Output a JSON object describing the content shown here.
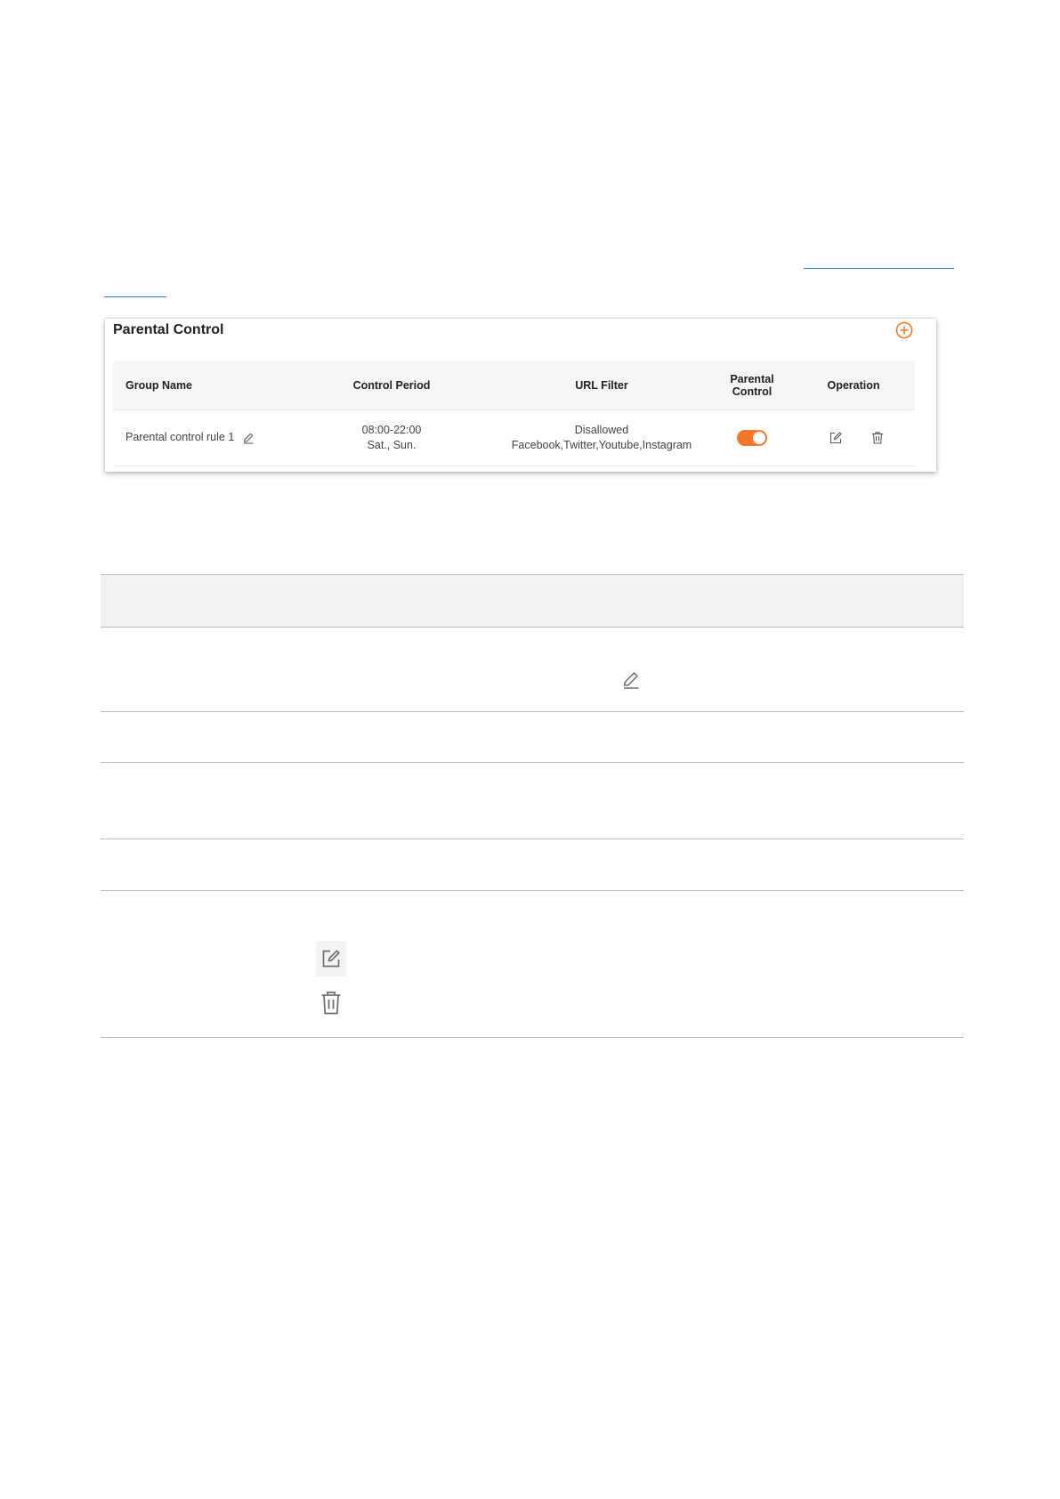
{
  "card": {
    "title": "Parental Control",
    "add_icon": "plus-circle-icon",
    "columns": {
      "group_name": "Group Name",
      "control_period": "Control Period",
      "url_filter": "URL Filter",
      "parental_control_line1": "Parental",
      "parental_control_line2": "Control",
      "operation": "Operation"
    },
    "rows": [
      {
        "group_name": "Parental control rule 1",
        "period_time": "08:00-22:00",
        "period_days": "Sat., Sun.",
        "filter_mode": "Disallowed",
        "filter_sites": "Facebook,Twitter,Youtube,Instagram",
        "parental_control_enabled": true
      }
    ]
  },
  "description_table": {
    "icons": [
      "pencil-icon",
      "edit-icon",
      "trash-icon"
    ]
  },
  "colors": {
    "accent_orange": "#f5782a",
    "link_blue": "#2f74d0",
    "header_gray": "#f2f2f2",
    "rule_gray": "#bfbfbf"
  }
}
